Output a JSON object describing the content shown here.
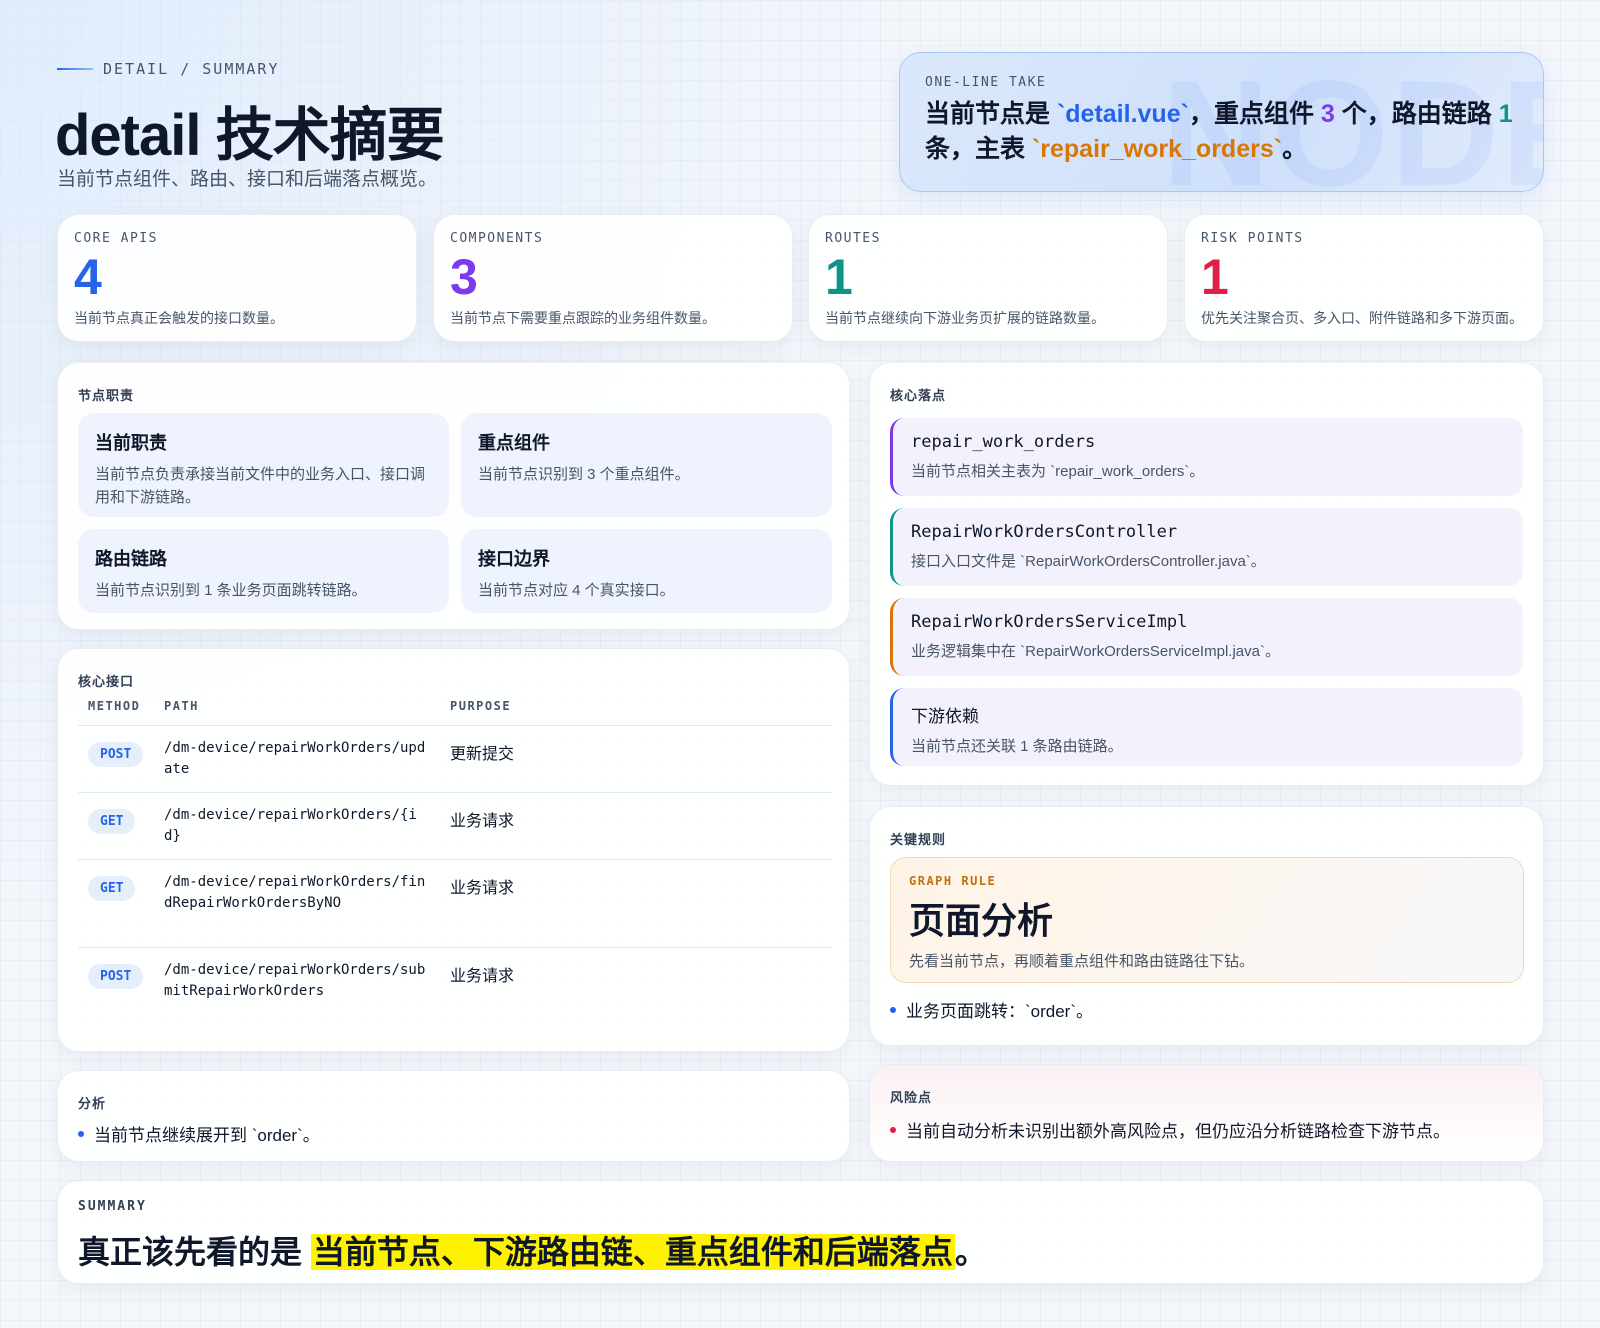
{
  "header": {
    "eyebrow": "DETAIL / SUMMARY",
    "title": "detail 技术摘要",
    "subtitle": "当前节点组件、路由、接口和后端落点概览。"
  },
  "take": {
    "label": "ONE-LINE TAKE",
    "watermark": "NODE",
    "p1": "当前节点是 ",
    "file": "`detail.vue`",
    "p2": "，重点组件 ",
    "components": "3",
    "p3": " 个，路由链路 ",
    "routes": "1",
    "p4": " 条，主表 ",
    "table": "`repair_work_orders`",
    "p5": "。"
  },
  "stats": [
    {
      "label": "CORE APIS",
      "value": "4",
      "color": "#2563eb",
      "desc": "当前节点真正会触发的接口数量。"
    },
    {
      "label": "COMPONENTS",
      "value": "3",
      "color": "#7c3aed",
      "desc": "当前节点下需要重点跟踪的业务组件数量。"
    },
    {
      "label": "ROUTES",
      "value": "1",
      "color": "#0d9488",
      "desc": "当前节点继续向下游业务页扩展的链路数量。"
    },
    {
      "label": "RISK POINTS",
      "value": "1",
      "color": "#e11d48",
      "desc": "优先关注聚合页、多入口、附件链路和多下游页面。"
    }
  ],
  "duty": {
    "title": "节点职责",
    "items": [
      {
        "title": "当前职责",
        "desc": "当前节点负责承接当前文件中的业务入口、接口调用和下游链路。"
      },
      {
        "title": "重点组件",
        "desc": "当前节点识别到 3 个重点组件。"
      },
      {
        "title": "路由链路",
        "desc": "当前节点识别到 1 条业务页面跳转链路。"
      },
      {
        "title": "接口边界",
        "desc": "当前节点对应 4 个真实接口。"
      }
    ]
  },
  "landing": {
    "title": "核心落点",
    "items": [
      {
        "title": "repair_work_orders",
        "desc": "当前节点相关主表为 `repair_work_orders`。",
        "color": "#7c3aed",
        "mono": true
      },
      {
        "title": "RepairWorkOrdersController",
        "desc": "接口入口文件是 `RepairWorkOrdersController.java`。",
        "color": "#0d9488",
        "mono": true
      },
      {
        "title": "RepairWorkOrdersServiceImpl",
        "desc": "业务逻辑集中在 `RepairWorkOrdersServiceImpl.java`。",
        "color": "#d97706",
        "mono": true
      },
      {
        "title": "下游依赖",
        "desc": "当前节点还关联 1 条路由链路。",
        "color": "#2563eb",
        "mono": false
      }
    ]
  },
  "apis": {
    "title": "核心接口",
    "headers": [
      "METHOD",
      "PATH",
      "PURPOSE"
    ],
    "rows": [
      {
        "method": "POST",
        "path": "/dm-device/repairWorkOrders/update",
        "purpose": "更新提交"
      },
      {
        "method": "GET",
        "path": "/dm-device/repairWorkOrders/{id}",
        "purpose": "业务请求"
      },
      {
        "method": "GET",
        "path": "/dm-device/repairWorkOrders/findRepairWorkOrdersByNO",
        "purpose": "业务请求"
      },
      {
        "method": "POST",
        "path": "/dm-device/repairWorkOrders/submitRepairWorkOrders",
        "purpose": "业务请求"
      }
    ]
  },
  "rules": {
    "title": "关键规则",
    "tag": "GRAPH RULE",
    "rule_title": "页面分析",
    "rule_desc": "先看当前节点，再顺着重点组件和路由链路往下钻。",
    "bullet": "业务页面跳转：`order`。"
  },
  "analysis": {
    "title": "分析",
    "bullet": "当前节点继续展开到 `order`。"
  },
  "risk": {
    "title": "风险点",
    "bullet": "当前自动分析未识别出额外高风险点，但仍应沿分析链路检查下游节点。"
  },
  "summary": {
    "label": "SUMMARY",
    "lead": "真正该先看的是 ",
    "highlight": "当前节点、下游路由链、重点组件和后端落点",
    "end": "。"
  }
}
